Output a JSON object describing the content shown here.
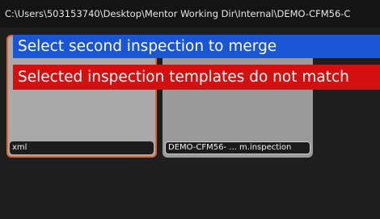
{
  "path_bar": {
    "text": "C:\\Users\\503153740\\Desktop\\Mentor Working Dir\\Internal\\DEMO-CFM56-C"
  },
  "tiles": [
    {
      "caption": "xml",
      "selected": true
    },
    {
      "caption": "DEMO-CFM56- ... m.inspection",
      "selected": false
    }
  ],
  "messages": {
    "info": "Select second inspection to merge",
    "error": "Selected inspection templates do not match"
  },
  "colors": {
    "info_bg": "#1a55d6",
    "error_bg": "#d30f0f",
    "selection_border": "#e3642b"
  }
}
